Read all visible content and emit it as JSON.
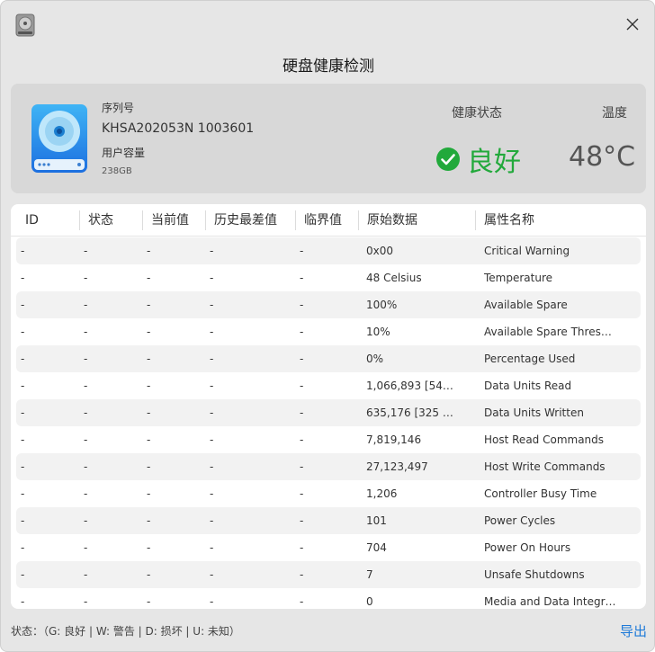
{
  "dialog": {
    "title": "硬盘健康检测",
    "icon": "disk-app-icon",
    "close_icon": "close-icon"
  },
  "summary": {
    "serial_label": "序列号",
    "serial_value": "KHSA202053N 1003601",
    "capacity_label": "用户容量",
    "capacity_value": "238GB",
    "health_label": "健康状态",
    "health_value": "良好",
    "health_color": "#22a93b",
    "temp_label": "温度",
    "temp_value": "48°C"
  },
  "table": {
    "headers": [
      "ID",
      "状态",
      "当前值",
      "历史最差值",
      "临界值",
      "原始数据",
      "属性名称"
    ],
    "rows": [
      {
        "id": "-",
        "status": "-",
        "current": "-",
        "worst": "-",
        "threshold": "-",
        "raw": "0x00",
        "name": "Critical Warning"
      },
      {
        "id": "-",
        "status": "-",
        "current": "-",
        "worst": "-",
        "threshold": "-",
        "raw": "48 Celsius",
        "name": "Temperature"
      },
      {
        "id": "-",
        "status": "-",
        "current": "-",
        "worst": "-",
        "threshold": "-",
        "raw": "100%",
        "name": "Available Spare"
      },
      {
        "id": "-",
        "status": "-",
        "current": "-",
        "worst": "-",
        "threshold": "-",
        "raw": "10%",
        "name": "Available Spare Thres…"
      },
      {
        "id": "-",
        "status": "-",
        "current": "-",
        "worst": "-",
        "threshold": "-",
        "raw": "0%",
        "name": "Percentage Used"
      },
      {
        "id": "-",
        "status": "-",
        "current": "-",
        "worst": "-",
        "threshold": "-",
        "raw": "1,066,893 [54…",
        "name": "Data Units Read"
      },
      {
        "id": "-",
        "status": "-",
        "current": "-",
        "worst": "-",
        "threshold": "-",
        "raw": "635,176 [325 …",
        "name": "Data Units Written"
      },
      {
        "id": "-",
        "status": "-",
        "current": "-",
        "worst": "-",
        "threshold": "-",
        "raw": "7,819,146",
        "name": "Host Read Commands"
      },
      {
        "id": "-",
        "status": "-",
        "current": "-",
        "worst": "-",
        "threshold": "-",
        "raw": "27,123,497",
        "name": "Host Write Commands"
      },
      {
        "id": "-",
        "status": "-",
        "current": "-",
        "worst": "-",
        "threshold": "-",
        "raw": "1,206",
        "name": "Controller Busy Time"
      },
      {
        "id": "-",
        "status": "-",
        "current": "-",
        "worst": "-",
        "threshold": "-",
        "raw": "101",
        "name": "Power Cycles"
      },
      {
        "id": "-",
        "status": "-",
        "current": "-",
        "worst": "-",
        "threshold": "-",
        "raw": "704",
        "name": "Power On Hours"
      },
      {
        "id": "-",
        "status": "-",
        "current": "-",
        "worst": "-",
        "threshold": "-",
        "raw": "7",
        "name": "Unsafe Shutdowns"
      },
      {
        "id": "-",
        "status": "-",
        "current": "-",
        "worst": "-",
        "threshold": "-",
        "raw": "0",
        "name": "Media and Data Integr…"
      }
    ]
  },
  "footer": {
    "legend": "状态：（G: 良好  | W: 警告 | D: 损坏 | U: 未知）",
    "export_label": "导出",
    "link_color": "#1e7ad8"
  }
}
